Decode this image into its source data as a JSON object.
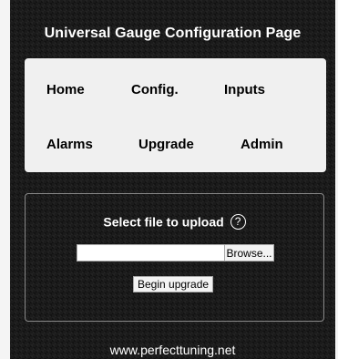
{
  "header": {
    "title": "Universal Gauge Configuration Page"
  },
  "nav": {
    "items": [
      {
        "label": "Home"
      },
      {
        "label": "Config."
      },
      {
        "label": "Inputs"
      },
      {
        "label": "Alarms"
      },
      {
        "label": "Upgrade"
      },
      {
        "label": "Admin"
      }
    ]
  },
  "upload": {
    "heading": "Select file to upload",
    "help_symbol": "?",
    "file_value": "",
    "browse_label": "Browse...",
    "begin_label": "Begin upgrade"
  },
  "footer": {
    "link_text": "www.perfecttuning.net"
  },
  "colors": {
    "background": "#1b1b1b",
    "panel": "#f0f0f0",
    "text_light": "#ffffff",
    "text_dark": "#000000"
  }
}
